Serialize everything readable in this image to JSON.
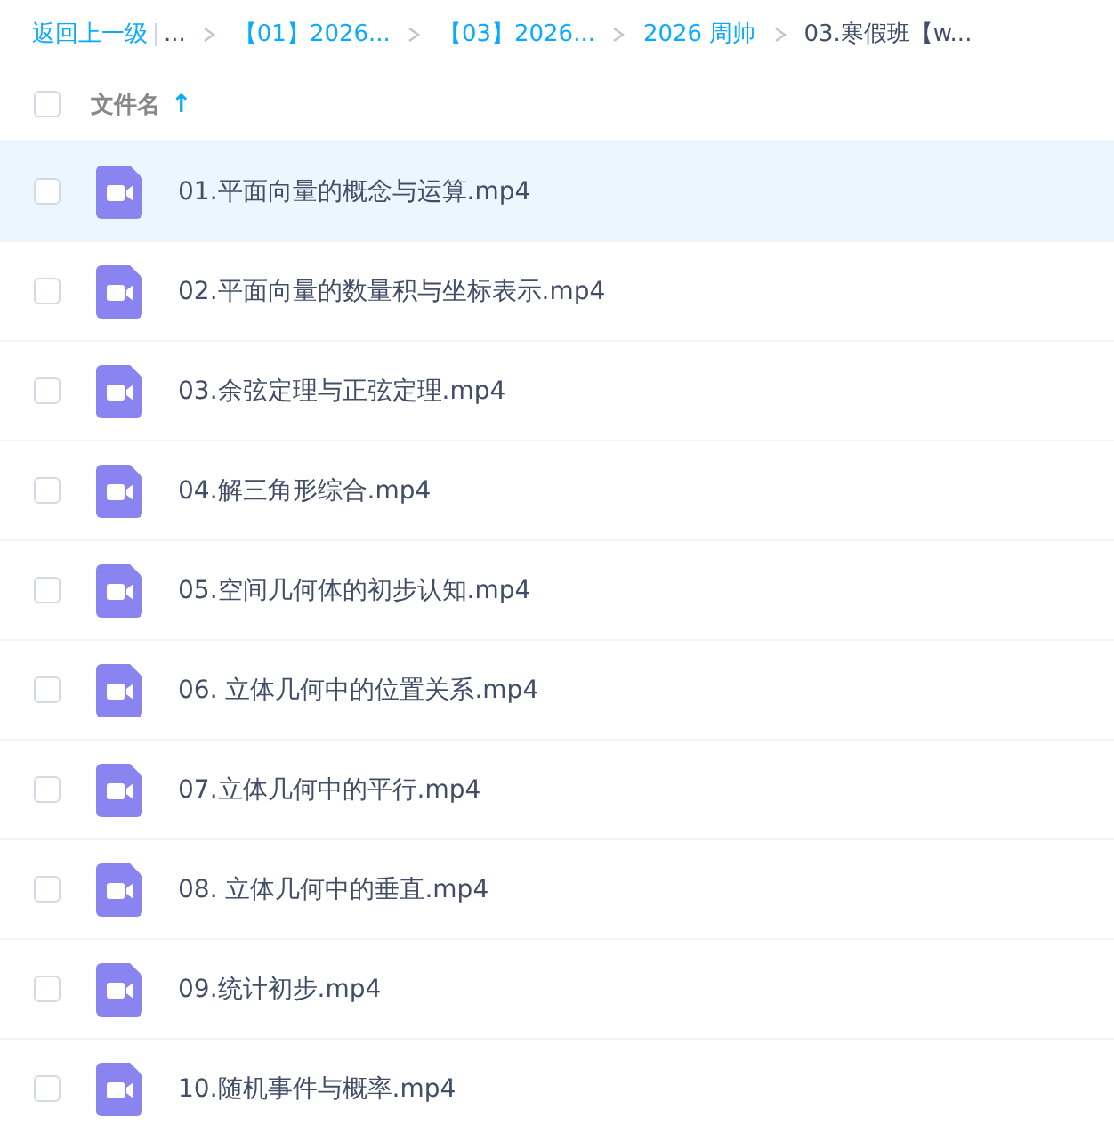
{
  "breadcrumb": {
    "back": "返回上一级",
    "items": [
      {
        "label": "...",
        "link": false
      },
      {
        "label": "【01】2026...",
        "link": true
      },
      {
        "label": "【03】2026...",
        "link": true
      },
      {
        "label": "2026 周帅",
        "link": true
      },
      {
        "label": "03.寒假班【w...",
        "link": false
      }
    ]
  },
  "header": {
    "checked": false,
    "column": "文件名",
    "sort_icon": "↑"
  },
  "files": [
    {
      "name": "01.平面向量的概念与运算.mp4",
      "checked": false,
      "highlighted": true
    },
    {
      "name": "02.平面向量的数量积与坐标表示.mp4",
      "checked": false,
      "highlighted": false
    },
    {
      "name": "03.余弦定理与正弦定理.mp4",
      "checked": false,
      "highlighted": false
    },
    {
      "name": "04.解三角形综合.mp4",
      "checked": false,
      "highlighted": false
    },
    {
      "name": "05.空间几何体的初步认知.mp4",
      "checked": false,
      "highlighted": false
    },
    {
      "name": "06. 立体几何中的位置关系.mp4",
      "checked": false,
      "highlighted": false
    },
    {
      "name": "07.立体几何中的平行.mp4",
      "checked": false,
      "highlighted": false
    },
    {
      "name": "08. 立体几何中的垂直.mp4",
      "checked": false,
      "highlighted": false
    },
    {
      "name": "09.统计初步.mp4",
      "checked": false,
      "highlighted": false
    },
    {
      "name": "10.随机事件与概率.mp4",
      "checked": false,
      "highlighted": false
    }
  ]
}
